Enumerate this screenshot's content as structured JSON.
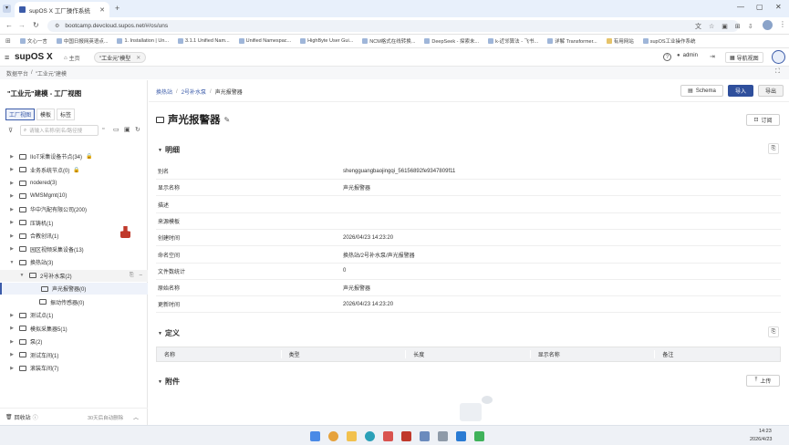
{
  "browser": {
    "tab_title": "supOS X 工厂操作系统",
    "url": "bootcamp.devcloud.supos.net/#/os/uns",
    "bookmarks": [
      "文心一言",
      "中国日报网英语点...",
      "1. Installation | Un...",
      "3.1.1 Unified Nam...",
      "Unified Namespac...",
      "HighByte User Gui...",
      "NCM格式在线转换...",
      "DeepSeek - 探索未...",
      "k-近邻算法 - 飞书...",
      "详解 Transformer...",
      "有用网站",
      "supOS工业操作系统"
    ]
  },
  "app": {
    "logo": "supOS X",
    "home_tab": "主页",
    "active_tab": "\"工业元\"模型",
    "user": "admin",
    "nav_view": "导航视图"
  },
  "breadcrumb_top": [
    "数据平台",
    "\"工业元\"建模"
  ],
  "left": {
    "title": "\"工业元\"建模 - 工厂视图",
    "view_tabs": [
      "工厂视图",
      "模板",
      "标签"
    ],
    "search_placeholder": "请输入名称/别名/路径搜",
    "tree": [
      {
        "label": "IIoT采集设备节点(34)",
        "level": 0,
        "lock": true
      },
      {
        "label": "业务系统节点(0)",
        "level": 0,
        "lock": true
      },
      {
        "label": "nodered(3)",
        "level": 0
      },
      {
        "label": "WMSMgmt(10)",
        "level": 0
      },
      {
        "label": "华中汽配有限公司(200)",
        "level": 0
      },
      {
        "label": "压铸机(1)",
        "level": 0
      },
      {
        "label": "合教创讯(1)",
        "level": 0
      },
      {
        "label": "园区视频采集设备(13)",
        "level": 0
      },
      {
        "label": "换热站(3)",
        "level": 0,
        "open": true
      },
      {
        "label": "2号补水泵(2)",
        "level": 1,
        "open": true
      },
      {
        "label": "声光报警器(0)",
        "level": 2,
        "selected": true
      },
      {
        "label": "振动传感器(0)",
        "level": 2
      },
      {
        "label": "测试点(1)",
        "level": 0
      },
      {
        "label": "模拟采集器5(1)",
        "level": 0
      },
      {
        "label": "泵(2)",
        "level": 0
      },
      {
        "label": "测试车间(1)",
        "level": 0
      },
      {
        "label": "滚装车间(7)",
        "level": 0
      }
    ],
    "recycle": "回收站",
    "recycle_note": "30天后自动删除"
  },
  "right": {
    "crumbs": [
      "换热站",
      "2号补水泵",
      "声光报警器"
    ],
    "btn_schema": "Schema",
    "btn_import": "导入",
    "btn_export": "导出",
    "title": "声光报警器",
    "btn_subscribe": "订阅",
    "section_detail": "明细",
    "fields": [
      {
        "label": "别名",
        "value": "shengguangbaojingqi_56156892fe9347809f11"
      },
      {
        "label": "显示名称",
        "value": "声光报警器"
      },
      {
        "label": "描述",
        "value": ""
      },
      {
        "label": "来源模板",
        "value": ""
      },
      {
        "label": "创建时间",
        "value": "2026/04/23 14:23:20"
      },
      {
        "label": "命名空间",
        "value": "换热站/2号补水泵/声光报警器"
      },
      {
        "label": "文件数统计",
        "value": "0"
      },
      {
        "label": "原始名称",
        "value": "声光报警器"
      },
      {
        "label": "更新时间",
        "value": "2026/04/23 14:23:20"
      }
    ],
    "section_def": "定义",
    "def_columns": [
      "名称",
      "类型",
      "长度",
      "显示名称",
      "备注"
    ],
    "section_attach": "附件",
    "btn_upload": "上传"
  },
  "taskbar": {
    "time": "14:23",
    "date": "2026/4/23"
  },
  "colors": {
    "accent": "#3b5ba9",
    "selected_bg": "#eef2fa",
    "import_bg": "#2f4f9c"
  }
}
